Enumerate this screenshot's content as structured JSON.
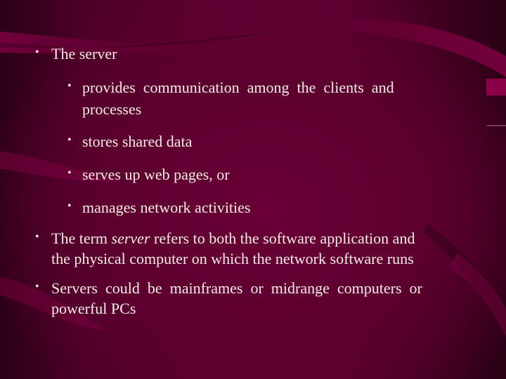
{
  "slide": {
    "bullets": [
      {
        "level": 1,
        "text": "The server",
        "children": [
          {
            "level": 2,
            "line1": "provides  communication  among  the  clients  and",
            "line2": "processes"
          },
          {
            "level": 2,
            "text": "stores shared data"
          },
          {
            "level": 2,
            "text": "serves up web pages, or"
          },
          {
            "level": 2,
            "text": "manages network activities"
          }
        ]
      },
      {
        "level": 1,
        "pre": "The term ",
        "emphasis": "server",
        "post": " refers to both the software application and",
        "line2": "the physical computer on which the network software runs"
      },
      {
        "level": 1,
        "line1": "Servers  could  be  mainframes  or  midrange  computers  or",
        "line2": "powerful PCs"
      }
    ],
    "bullet_glyph": "•"
  },
  "colors": {
    "background": "#5c002f",
    "background_dark": "#2c0016",
    "swoosh": "#7a0040",
    "text": "#f6ece4"
  }
}
